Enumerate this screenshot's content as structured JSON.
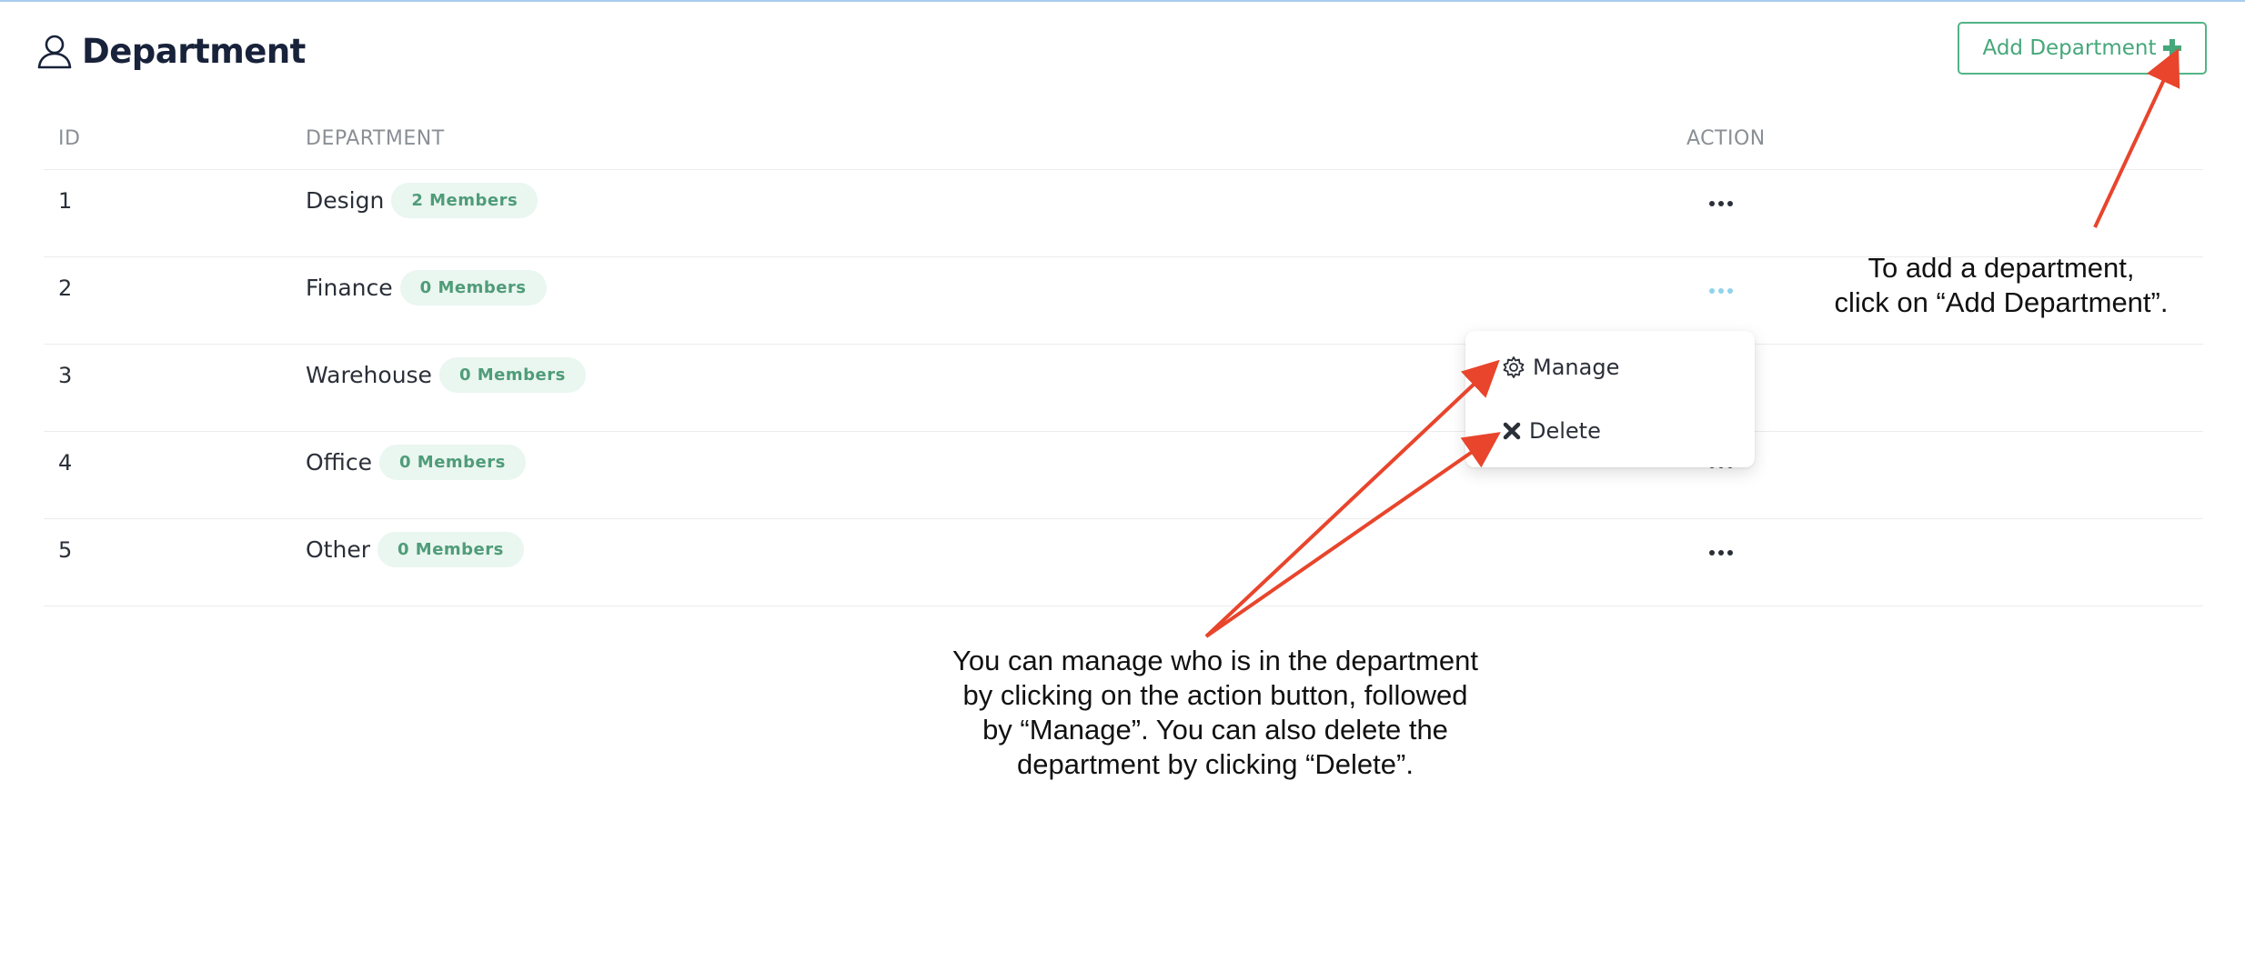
{
  "header": {
    "title": "Department",
    "add_button_label": "Add Department"
  },
  "table": {
    "columns": {
      "id": "ID",
      "department": "DEPARTMENT",
      "action": "ACTION"
    },
    "rows": [
      {
        "id": "1",
        "name": "Design",
        "members": "2 Members"
      },
      {
        "id": "2",
        "name": "Finance",
        "members": "0 Members"
      },
      {
        "id": "3",
        "name": "Warehouse",
        "members": "0 Members"
      },
      {
        "id": "4",
        "name": "Office",
        "members": "0 Members"
      },
      {
        "id": "5",
        "name": "Other",
        "members": "0 Members"
      }
    ]
  },
  "dropdown": {
    "manage_label": "Manage",
    "delete_label": "Delete"
  },
  "annotations": {
    "add_hint_line1": "To add a department,",
    "add_hint_line2": "click on “Add Department”.",
    "manage_hint_line1": "You can manage who is in the department",
    "manage_hint_line2": "by clicking on the action button, followed",
    "manage_hint_line3": "by “Manage”. You can also delete the",
    "manage_hint_line4": "department by clicking “Delete”."
  },
  "colors": {
    "accent_green": "#46a77a",
    "badge_bg": "#eaf6f0",
    "arrow_red": "#e8452c",
    "active_dots": "#8fd3ea"
  }
}
